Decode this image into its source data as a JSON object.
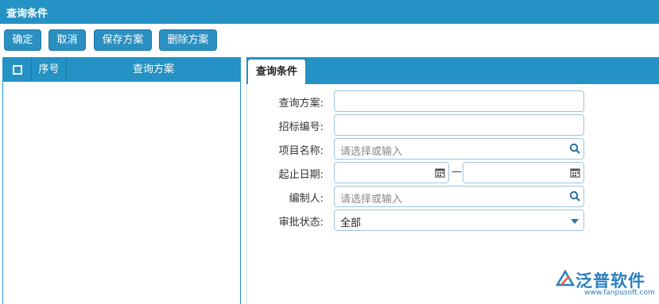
{
  "window": {
    "title": "查询条件"
  },
  "toolbar": {
    "confirm": "确定",
    "cancel": "取消",
    "save_scheme": "保存方案",
    "delete_scheme": "删除方案"
  },
  "scheme_grid": {
    "columns": [
      "序号",
      "查询方案"
    ],
    "rows": []
  },
  "tab": {
    "label": "查询条件"
  },
  "form": {
    "scheme": {
      "label": "查询方案:",
      "value": ""
    },
    "bid_no": {
      "label": "招标编号:",
      "value": ""
    },
    "project": {
      "label": "项目名称:",
      "placeholder": "请选择或输入"
    },
    "date": {
      "label": "起止日期:",
      "separator": "—"
    },
    "preparer": {
      "label": "编制人:",
      "placeholder": "请选择或输入"
    },
    "status": {
      "label": "审批状态:",
      "value": "全部"
    }
  },
  "brand": {
    "name": "泛普软件",
    "url": "www.fanpusoft.com"
  },
  "colors": {
    "primary": "#2492c4",
    "button": "#2a8fc1",
    "border": "#9ec5dc"
  }
}
